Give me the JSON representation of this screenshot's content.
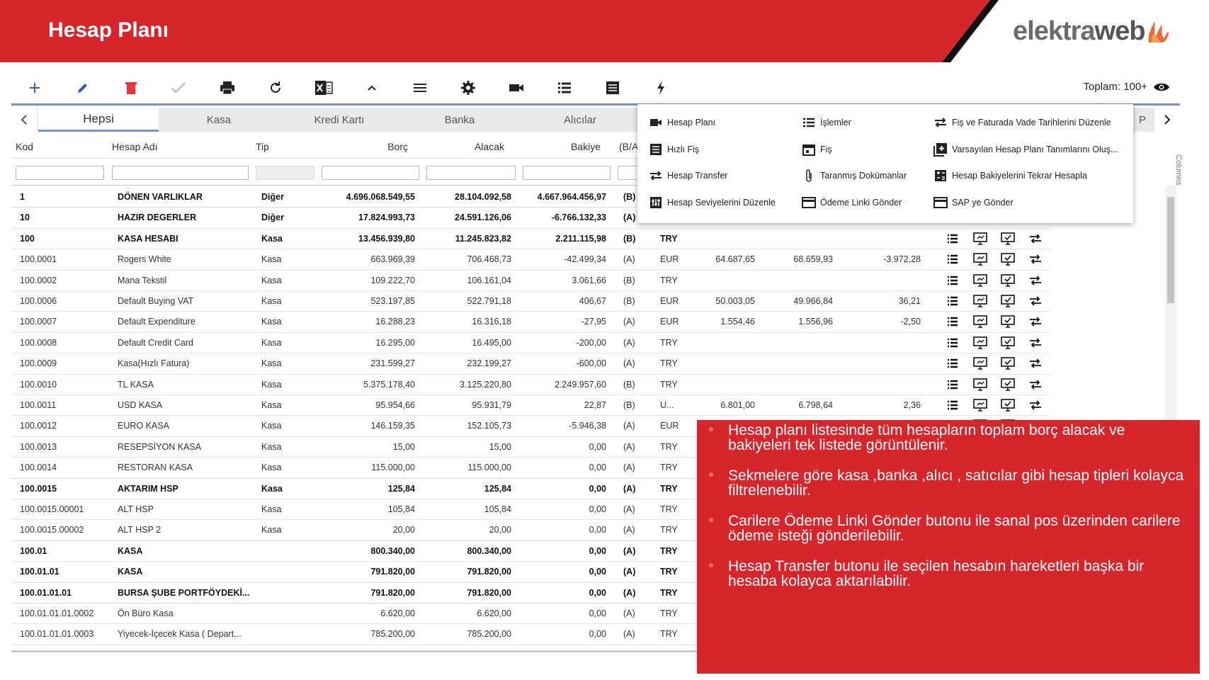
{
  "header": {
    "title": "Hesap Planı",
    "logo_text_a": "elektra",
    "logo_text_b": "web",
    "colors": {
      "brand_red": "#d7262b",
      "accent_blue": "#7b93c6"
    }
  },
  "toolbar": {
    "buttons": [
      "add-icon",
      "edit-icon",
      "delete-icon",
      "check-icon",
      "print-icon",
      "refresh-icon",
      "excel-icon",
      "chevron-up-icon",
      "menu-icon",
      "gear-icon",
      "video-icon",
      "list-icon",
      "document-icon",
      "bolt-icon"
    ],
    "total_label": "Toplam: 100+"
  },
  "tabs": {
    "items": [
      "Hepsi",
      "Kasa",
      "Kredi Kartı",
      "Banka",
      "Alıcılar"
    ],
    "active": "Hepsi",
    "partial_tab": "P"
  },
  "grid": {
    "columns": [
      "Kod",
      "Hesap Adı",
      "Tip",
      "Borç",
      "Alacak",
      "Bakiye",
      "(B/A"
    ],
    "rows": [
      {
        "kod": "1",
        "ad": "DÖNEN VARLIKLAR",
        "tip": "Diğer",
        "borc": "4.696.068.549,55",
        "alacak": "28.104.092,58",
        "bakiye": "4.667.964.456,97",
        "ba": "(B)",
        "cur": "",
        "d1": "",
        "d2": "",
        "d3": "",
        "bold": true
      },
      {
        "kod": "10",
        "ad": "HAZIR DEGERLER",
        "tip": "Diğer",
        "borc": "17.824.993,73",
        "alacak": "24.591.126,06",
        "bakiye": "-6.766.132,33",
        "ba": "(A)",
        "cur": "",
        "d1": "",
        "d2": "",
        "d3": "",
        "bold": true
      },
      {
        "kod": "100",
        "ad": "KASA HESABI",
        "tip": "Kasa",
        "borc": "13.456.939,80",
        "alacak": "11.245.823,82",
        "bakiye": "2.211.115,98",
        "ba": "(B)",
        "cur": "TRY",
        "d1": "",
        "d2": "",
        "d3": "",
        "bold": true
      },
      {
        "kod": "100.0001",
        "ad": "Rogers White",
        "tip": "Kasa",
        "borc": "663.969,39",
        "alacak": "706.468,73",
        "bakiye": "-42.499,34",
        "ba": "(A)",
        "cur": "EUR",
        "d1": "64.687,65",
        "d2": "68.659,93",
        "d3": "-3.972,28",
        "bold": false
      },
      {
        "kod": "100.0002",
        "ad": "Mana Tekstil",
        "tip": "Kasa",
        "borc": "109.222,70",
        "alacak": "106.161,04",
        "bakiye": "3.061,66",
        "ba": "(B)",
        "cur": "TRY",
        "d1": "",
        "d2": "",
        "d3": "",
        "bold": false
      },
      {
        "kod": "100.0006",
        "ad": "Default Buying VAT",
        "tip": "Kasa",
        "borc": "523.197,85",
        "alacak": "522.791,18",
        "bakiye": "406,67",
        "ba": "(B)",
        "cur": "EUR",
        "d1": "50.003,05",
        "d2": "49.966,84",
        "d3": "36,21",
        "bold": false
      },
      {
        "kod": "100.0007",
        "ad": "Default Expenditure",
        "tip": "Kasa",
        "borc": "16.288,23",
        "alacak": "16.316,18",
        "bakiye": "-27,95",
        "ba": "(A)",
        "cur": "EUR",
        "d1": "1.554,46",
        "d2": "1.556,96",
        "d3": "-2,50",
        "bold": false
      },
      {
        "kod": "100.0008",
        "ad": "Default Credit Card",
        "tip": "Kasa",
        "borc": "16.295,00",
        "alacak": "16.495,00",
        "bakiye": "-200,00",
        "ba": "(A)",
        "cur": "TRY",
        "d1": "",
        "d2": "",
        "d3": "",
        "bold": false
      },
      {
        "kod": "100.0009",
        "ad": "Kasa(Hızlı Fatura)",
        "tip": "Kasa",
        "borc": "231.599,27",
        "alacak": "232.199,27",
        "bakiye": "-600,00",
        "ba": "(A)",
        "cur": "TRY",
        "d1": "",
        "d2": "",
        "d3": "",
        "bold": false
      },
      {
        "kod": "100.0010",
        "ad": "TL KASA",
        "tip": "Kasa",
        "borc": "5.375.178,40",
        "alacak": "3.125.220,80",
        "bakiye": "2.249.957,60",
        "ba": "(B)",
        "cur": "TRY",
        "d1": "",
        "d2": "",
        "d3": "",
        "bold": false
      },
      {
        "kod": "100.0011",
        "ad": "USD KASA",
        "tip": "Kasa",
        "borc": "95.954,66",
        "alacak": "95.931,79",
        "bakiye": "22,87",
        "ba": "(B)",
        "cur": "U...",
        "d1": "6.801,00",
        "d2": "6.798,64",
        "d3": "2,36",
        "bold": false
      },
      {
        "kod": "100.0012",
        "ad": "EURO KASA",
        "tip": "Kasa",
        "borc": "146.159,35",
        "alacak": "152.105,73",
        "bakiye": "-5.946,38",
        "ba": "(A)",
        "cur": "EUR",
        "d1": "",
        "d2": "",
        "d3": "",
        "bold": false
      },
      {
        "kod": "100.0013",
        "ad": "RESEPSİYON KASA",
        "tip": "Kasa",
        "borc": "15,00",
        "alacak": "15,00",
        "bakiye": "0,00",
        "ba": "(A)",
        "cur": "TRY",
        "d1": "",
        "d2": "",
        "d3": "",
        "bold": false
      },
      {
        "kod": "100.0014",
        "ad": "RESTORAN KASA",
        "tip": "Kasa",
        "borc": "115.000,00",
        "alacak": "115.000,00",
        "bakiye": "0,00",
        "ba": "(A)",
        "cur": "TRY",
        "d1": "",
        "d2": "",
        "d3": "",
        "bold": false
      },
      {
        "kod": "100.0015",
        "ad": "AKTARIM HSP",
        "tip": "Kasa",
        "borc": "125,84",
        "alacak": "125,84",
        "bakiye": "0,00",
        "ba": "(A)",
        "cur": "TRY",
        "d1": "",
        "d2": "",
        "d3": "",
        "bold": true
      },
      {
        "kod": "100.0015.00001",
        "ad": "ALT HSP",
        "tip": "Kasa",
        "borc": "105,84",
        "alacak": "105,84",
        "bakiye": "0,00",
        "ba": "(A)",
        "cur": "TRY",
        "d1": "",
        "d2": "",
        "d3": "",
        "bold": false
      },
      {
        "kod": "100.0015.00002",
        "ad": "ALT HSP 2",
        "tip": "Kasa",
        "borc": "20,00",
        "alacak": "20,00",
        "bakiye": "0,00",
        "ba": "(A)",
        "cur": "TRY",
        "d1": "",
        "d2": "",
        "d3": "",
        "bold": false
      },
      {
        "kod": "100.01",
        "ad": "KASA",
        "tip": "",
        "borc": "800.340,00",
        "alacak": "800.340,00",
        "bakiye": "0,00",
        "ba": "(A)",
        "cur": "TRY",
        "d1": "",
        "d2": "",
        "d3": "",
        "bold": true
      },
      {
        "kod": "100.01.01",
        "ad": "KASA",
        "tip": "",
        "borc": "791.820,00",
        "alacak": "791.820,00",
        "bakiye": "0,00",
        "ba": "(A)",
        "cur": "TRY",
        "d1": "",
        "d2": "",
        "d3": "",
        "bold": true
      },
      {
        "kod": "100.01.01.01",
        "ad": "BURSA ŞUBE PORTFÖYDEKİ...",
        "tip": "",
        "borc": "791.820,00",
        "alacak": "791.820,00",
        "bakiye": "0,00",
        "ba": "(A)",
        "cur": "TRY",
        "d1": "",
        "d2": "",
        "d3": "",
        "bold": true
      },
      {
        "kod": "100.01.01.01.0002",
        "ad": "Ön Büro Kasa",
        "tip": "",
        "borc": "6.620,00",
        "alacak": "6.620,00",
        "bakiye": "0,00",
        "ba": "(A)",
        "cur": "TRY",
        "d1": "",
        "d2": "",
        "d3": "",
        "bold": false
      },
      {
        "kod": "100.01.01.01.0003",
        "ad": "Yiyecek-İçecek Kasa ( Depart...",
        "tip": "",
        "borc": "785.200,00",
        "alacak": "785.200,00",
        "bakiye": "0,00",
        "ba": "(A)",
        "cur": "TRY",
        "d1": "",
        "d2": "",
        "d3": "",
        "bold": false
      }
    ],
    "row_actions": [
      "list-icon",
      "monitor-icon",
      "monitor-check-icon",
      "transfer-icon"
    ],
    "columns_label": "Columns"
  },
  "menu": {
    "items": [
      {
        "label": "Hesap Planı",
        "icon": "video-icon"
      },
      {
        "label": "İşlemler",
        "icon": "list-icon"
      },
      {
        "label": "Fiş ve Faturada Vade Tarihlerini Düzenle",
        "icon": "transfer-icon"
      },
      {
        "label": "Hızlı Fiş",
        "icon": "document-icon"
      },
      {
        "label": "Fiş",
        "icon": "calendar-icon"
      },
      {
        "label": "Varsayılan Hesap Planı Tanımlarını Oluş...",
        "icon": "add-box-icon"
      },
      {
        "label": "Hesap Transfer",
        "icon": "transfer-icon"
      },
      {
        "label": "Taranmış Dokümanlar",
        "icon": "paperclip-icon"
      },
      {
        "label": "Hesap Bakiyelerini Tekrar Hesapla",
        "icon": "calculator-icon"
      },
      {
        "label": "Hesap Seviyelerini Düzenle",
        "icon": "levels-icon"
      },
      {
        "label": "Ödeme Linki Gönder",
        "icon": "card-icon"
      },
      {
        "label": "SAP ye Gönder",
        "icon": "card-icon"
      }
    ]
  },
  "info_panel": {
    "bullets": [
      "Hesap planı listesinde tüm hesapların toplam borç alacak ve bakiyeleri tek listede görüntülenir.",
      "Sekmelere göre kasa ,banka ,alıcı , satıcılar gibi hesap tipleri kolayca filtrelenebilir.",
      "Carilere Ödeme Linki Gönder butonu ile sanal pos üzerinden carilere ödeme isteği gönderilebilir.",
      "Hesap Transfer butonu ile seçilen hesabın hareketleri başka bir hesaba kolayca aktarılabilir."
    ]
  }
}
